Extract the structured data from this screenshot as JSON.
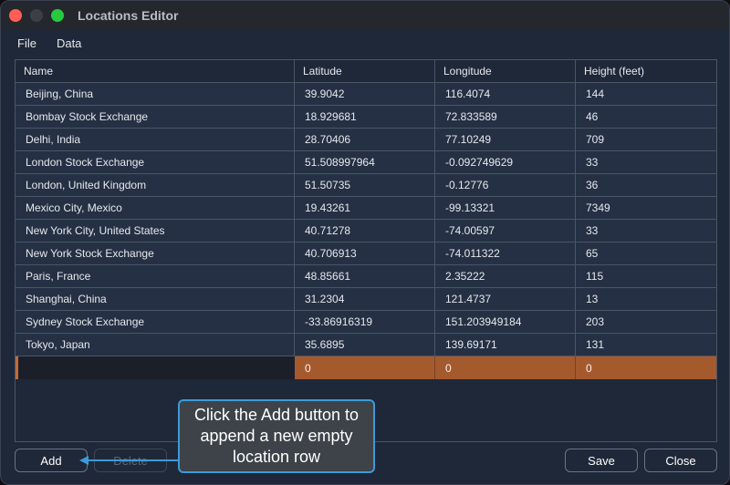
{
  "window": {
    "title": "Locations Editor"
  },
  "menu": [
    "File",
    "Data"
  ],
  "table": {
    "columns": [
      "Name",
      "Latitude",
      "Longitude",
      "Height (feet)"
    ],
    "rows": [
      [
        "Beijing, China",
        "39.9042",
        "116.4074",
        "144"
      ],
      [
        "Bombay Stock Exchange",
        "18.929681",
        "72.833589",
        "46"
      ],
      [
        "Delhi, India",
        "28.70406",
        "77.10249",
        "709"
      ],
      [
        "London Stock Exchange",
        "51.508997964",
        "-0.092749629",
        "33"
      ],
      [
        "London, United Kingdom",
        "51.50735",
        "-0.12776",
        "36"
      ],
      [
        "Mexico City, Mexico",
        "19.43261",
        "-99.13321",
        "7349"
      ],
      [
        "New York City, United States",
        "40.71278",
        "-74.00597",
        "33"
      ],
      [
        "New York Stock Exchange",
        "40.706913",
        "-74.011322",
        "65"
      ],
      [
        "Paris, France",
        "48.85661",
        "2.35222",
        "115"
      ],
      [
        "Shanghai, China",
        "31.2304",
        "121.4737",
        "13"
      ],
      [
        "Sydney Stock Exchange",
        "-33.86916319",
        "151.203949184",
        "203"
      ],
      [
        "Tokyo, Japan",
        "35.6895",
        "139.69171",
        "131"
      ]
    ],
    "new_row": [
      "",
      "0",
      "0",
      "0"
    ]
  },
  "buttons": {
    "add": "Add",
    "delete": "Delete",
    "save": "Save",
    "close": "Close"
  },
  "callout": {
    "text": "Click the Add button to append a new empty location row"
  },
  "colors": {
    "window_bg": "#1f2838",
    "row_bg": "#253044",
    "selected_cell": "#a55a2e",
    "callout_border": "#3d9ad8",
    "close_light": "#ff5f57",
    "max_light": "#28c840"
  }
}
